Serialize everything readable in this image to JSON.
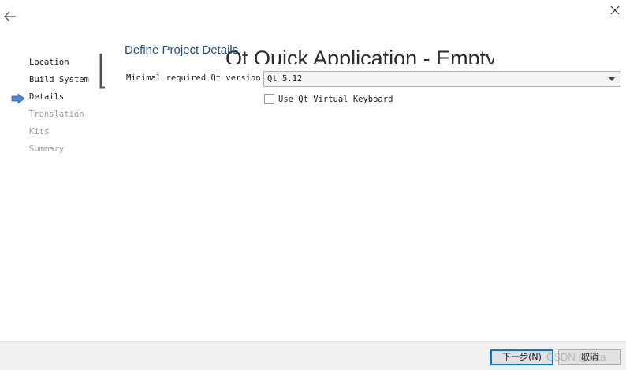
{
  "wizard": {
    "steps": [
      {
        "label": "Location",
        "state": "done"
      },
      {
        "label": "Build System",
        "state": "done"
      },
      {
        "label": "Details",
        "state": "current"
      },
      {
        "label": "Translation",
        "state": "pending"
      },
      {
        "label": "Kits",
        "state": "pending"
      },
      {
        "label": "Summary",
        "state": "pending"
      }
    ],
    "ghost_title": "Qt Quick Application - Empty"
  },
  "page": {
    "title": "Define Project Details",
    "qt_version_label": "Minimal required Qt version:",
    "qt_version_value": "Qt 5.12",
    "virtual_keyboard_label": "Use Qt Virtual Keyboard",
    "virtual_keyboard_checked": false
  },
  "footer": {
    "next_label": "下一步(N)",
    "cancel_label": "取消"
  },
  "watermark": "CSDN @tata",
  "colors": {
    "title_blue": "#1f4e8c",
    "current_arrow": "#4a86d8",
    "footer_bg": "#f0f0f0",
    "pending_text": "#9a9a9a"
  },
  "icons": {
    "back": "arrow-left-icon",
    "close": "close-icon",
    "current_step": "arrow-right-icon",
    "dropdown": "chevron-down-icon"
  }
}
